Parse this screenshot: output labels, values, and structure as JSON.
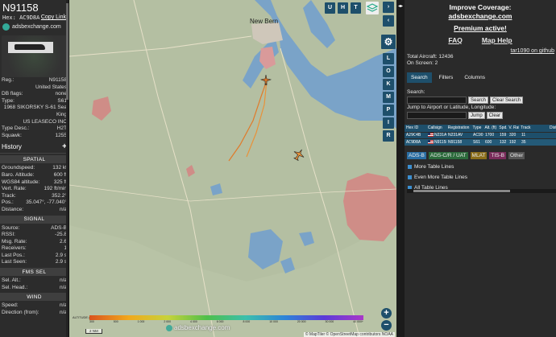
{
  "aircraft": {
    "callsign": "N91158",
    "hex_label": "Hex: AC9D8A",
    "copy_link": "Copy Link",
    "source": "adsbexchange.com",
    "details": [
      {
        "k": "Reg.:",
        "v": "N91158"
      },
      {
        "k": "",
        "v": "United States"
      },
      {
        "k": "DB flags:",
        "v": "none"
      },
      {
        "k": "Type:",
        "v": "S61"
      },
      {
        "k": "",
        "v": "1968 SIKORSKY S-61 Sea King"
      },
      {
        "k": "",
        "v": "US LEASECO INC"
      },
      {
        "k": "Type Desc.:",
        "v": "H2T"
      },
      {
        "k": "Squawk:",
        "v": "1255"
      }
    ],
    "history_label": "History",
    "spatial_label": "SPATIAL",
    "spatial": [
      {
        "k": "Groundspeed:",
        "v": "132 kt"
      },
      {
        "k": "Baro. Altitude:",
        "v": "600 ft"
      },
      {
        "k": "WGS84 altitude:",
        "v": "325 ft"
      },
      {
        "k": "Vert. Rate:",
        "v": "192 ft/min"
      },
      {
        "k": "Track:",
        "v": "352.2°"
      },
      {
        "k": "Pos.:",
        "v": "35.047°, -77.040°"
      },
      {
        "k": "Distance:",
        "v": "n/a"
      }
    ],
    "signal_label": "SIGNAL",
    "signal": [
      {
        "k": "Source:",
        "v": "ADS-B"
      },
      {
        "k": "RSSI:",
        "v": "-25.8"
      },
      {
        "k": "Msg. Rate:",
        "v": "2.6"
      },
      {
        "k": "Receivers:",
        "v": "1"
      },
      {
        "k": "Last Pos.:",
        "v": "2.9 s"
      },
      {
        "k": "Last Seen:",
        "v": "2.9 s"
      }
    ],
    "fmssel_label": "FMS SEL",
    "fmssel": [
      {
        "k": "Sel. Alt.:",
        "v": "n/a"
      },
      {
        "k": "Sel. Head.:",
        "v": "n/a"
      }
    ],
    "wind_label": "WIND",
    "wind": [
      {
        "k": "Speed:",
        "v": "n/a"
      },
      {
        "k": "Direction (from):",
        "v": "n/a"
      }
    ]
  },
  "map": {
    "city_label": "New Bern",
    "layer_buttons": [
      "U",
      "H",
      "T"
    ],
    "side_buttons": [
      "L",
      "O",
      "K",
      "M",
      "P",
      "I",
      "R"
    ],
    "zoom_in": "+",
    "zoom_out": "−",
    "altitude_label": "ALTITUDE (ft)",
    "altitude_ticks": [
      "300",
      "500",
      "1 000",
      "2 000",
      "4 000",
      "6 000",
      "8 000",
      "10 000",
      "20 000",
      "30 000",
      "40 000+"
    ],
    "scale": "2 NM",
    "watermark": "adsbexchange.com",
    "attribution": "© MapTiler © OpenStreetMap contributors NOAA"
  },
  "panel": {
    "improve_title": "Improve Coverage:",
    "improve_link": "adsbexchange.com",
    "premium": "Premium active!",
    "faq": "FAQ",
    "map_help": "Map Help",
    "receiver": "tar1090 on github",
    "total_label": "Total Aircraft: 12436",
    "onscreen_label": "On Screen: 2",
    "tabs": [
      "Search",
      "Filters",
      "Columns"
    ],
    "search_label": "Search:",
    "search_button": "Search",
    "clear_search": "Clear Search",
    "jump_label": "Jump to Airport or Latitude, Longitude:",
    "jump_button": "Jump",
    "clear_button": "Clear",
    "table_headers": [
      "Hex ID",
      "Callsign",
      "Registration",
      "Type",
      "Alt. (ft)",
      "Spd. (kt)",
      "V. Rate (ft/min)",
      "Track",
      "Dist."
    ],
    "rows": [
      {
        "hex": "A29C4B",
        "callsign": "N231AV",
        "reg": "N231AV",
        "type": "AC90",
        "alt": "1700",
        "spd": "159",
        "vrate": "320",
        "track": "11"
      },
      {
        "hex": "AC9D8A",
        "callsign": "N91158",
        "reg": "N91158",
        "type": "S61",
        "alt": "600",
        "spd": "132",
        "vrate": "192",
        "track": "35"
      }
    ],
    "filters": [
      "ADS-B",
      "ADS-C/R / UAT",
      "MLAT",
      "TIS-B",
      "Other"
    ],
    "checks": [
      "More Table Lines",
      "Even More Table Lines",
      "All Table Lines"
    ]
  }
}
